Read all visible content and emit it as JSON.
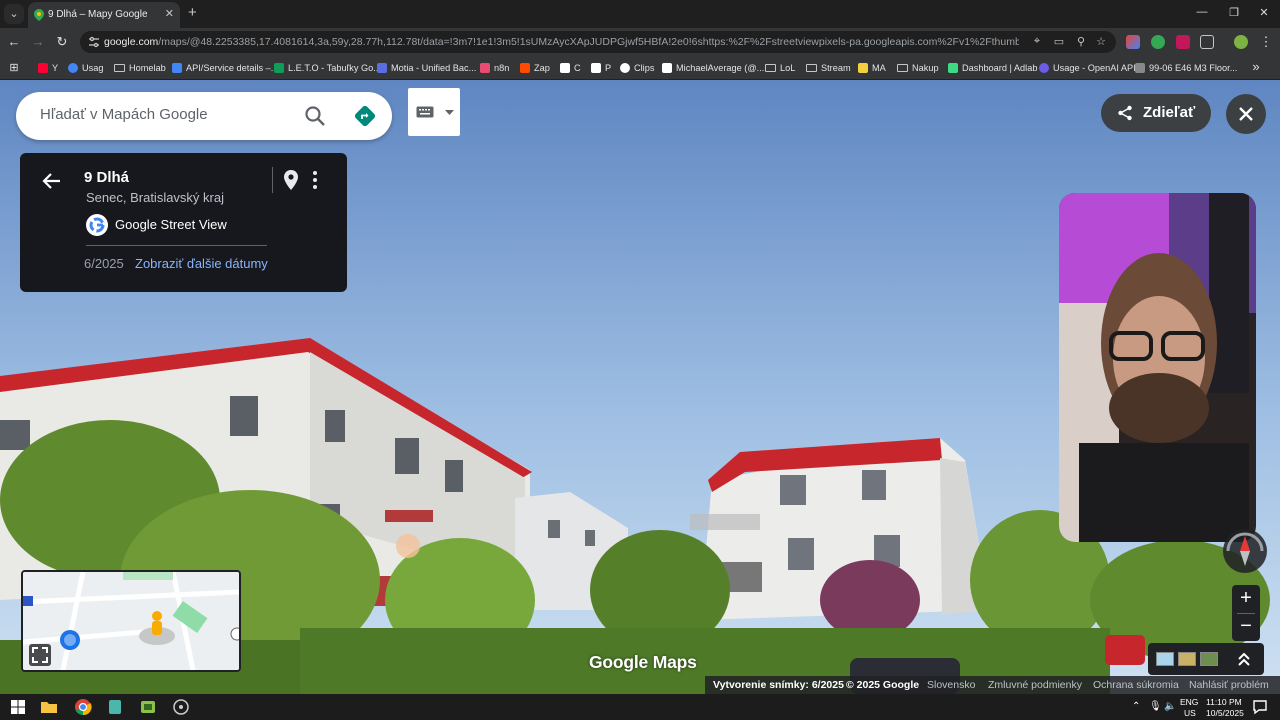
{
  "tab": {
    "title": "9 Dlhá – Mapy Google",
    "close": "✕",
    "new": "+"
  },
  "window": {
    "minimize": "—",
    "restore": "❐",
    "close": "✕"
  },
  "toolbar": {
    "back": "←",
    "forward": "→",
    "reload": "↻",
    "url_domain": "google.com",
    "url_path": "/maps/@48.2253385,17.4081614,3a,59y,28.77h,112.78t/data=!3m7!1e1!3m5!1sUMzAycXApJUDPGjwf5HBfA!2e0!6shttps:%2F%2Fstreetviewpixels-pa.googleapis.com%2Fv1%2Fthumbnail%3Fcb_client%3Dmaps_..."
  },
  "bookmarks": [
    {
      "label": "Y",
      "icon": "youtube-icon",
      "color": "#ff0033"
    },
    {
      "label": "Usag",
      "icon": "globe-icon",
      "color": "#4285f4"
    },
    {
      "label": "Homelab",
      "icon": "folder-icon",
      "color": ""
    },
    {
      "label": "API/Service details –...",
      "icon": "cloud-icon",
      "color": "#4285f4"
    },
    {
      "label": "L.E.T.O - Tabuľky Go...",
      "icon": "sheets-icon",
      "color": "#0f9d58"
    },
    {
      "label": "Motia - Unified Bac...",
      "icon": "motia-icon",
      "color": "#5b6ee1"
    },
    {
      "label": "n8n",
      "icon": "n8n-icon",
      "color": "#ea4b71"
    },
    {
      "label": "Zap",
      "icon": "zapier-icon",
      "color": "#ff4a00"
    },
    {
      "label": "C",
      "icon": "c-icon",
      "color": "#ffffff"
    },
    {
      "label": "P",
      "icon": "p-icon",
      "color": "#ffffff"
    },
    {
      "label": "Clips",
      "icon": "clips-icon",
      "color": "#ffffff"
    },
    {
      "label": "MichaelAverage (@...",
      "icon": "tiktok-icon",
      "color": "#ffffff"
    },
    {
      "label": "LoL",
      "icon": "folder-icon",
      "color": ""
    },
    {
      "label": "Stream",
      "icon": "folder-icon",
      "color": ""
    },
    {
      "label": "MA",
      "icon": "ma-icon",
      "color": "#f4d03f"
    },
    {
      "label": "Nakup",
      "icon": "folder-icon",
      "color": ""
    },
    {
      "label": "Dashboard | Adlab",
      "icon": "adlab-icon",
      "color": "#3ddc84"
    },
    {
      "label": "Usage - OpenAI API",
      "icon": "openai-icon",
      "color": "#6c5ce7"
    },
    {
      "label": "99-06 E46 M3 Floor...",
      "icon": "bmw-icon",
      "color": "#888888"
    }
  ],
  "bookmarks_overflow": "»",
  "maps": {
    "search_placeholder": "Hľadať v Mapách Google",
    "share_label": "Zdieľať",
    "address_title": "9 Dlhá",
    "address_subtitle": "Senec, Bratislavský kraj",
    "street_view_label": "Google Street View",
    "capture_date": "6/2025",
    "more_dates": "Zobraziť ďalšie dátumy",
    "logo": "Google Maps",
    "zoom_in": "+",
    "zoom_out": "−",
    "watermark": "© 2025 Google"
  },
  "footer": {
    "capture": "Vytvorenie snímky: 6/2025",
    "copyright": "© 2025 Google",
    "country": "Slovensko",
    "terms": "Zmluvné podmienky",
    "privacy": "Ochrana súkromia",
    "report": "Nahlásiť problém"
  },
  "tray": {
    "lang": "ENG",
    "region": "US",
    "time": "11:10 PM",
    "date": "10/5/2025"
  },
  "colors": {
    "maps_green": "#00897b",
    "link_blue": "#8ab4f8",
    "card_bg": "#16181d"
  }
}
